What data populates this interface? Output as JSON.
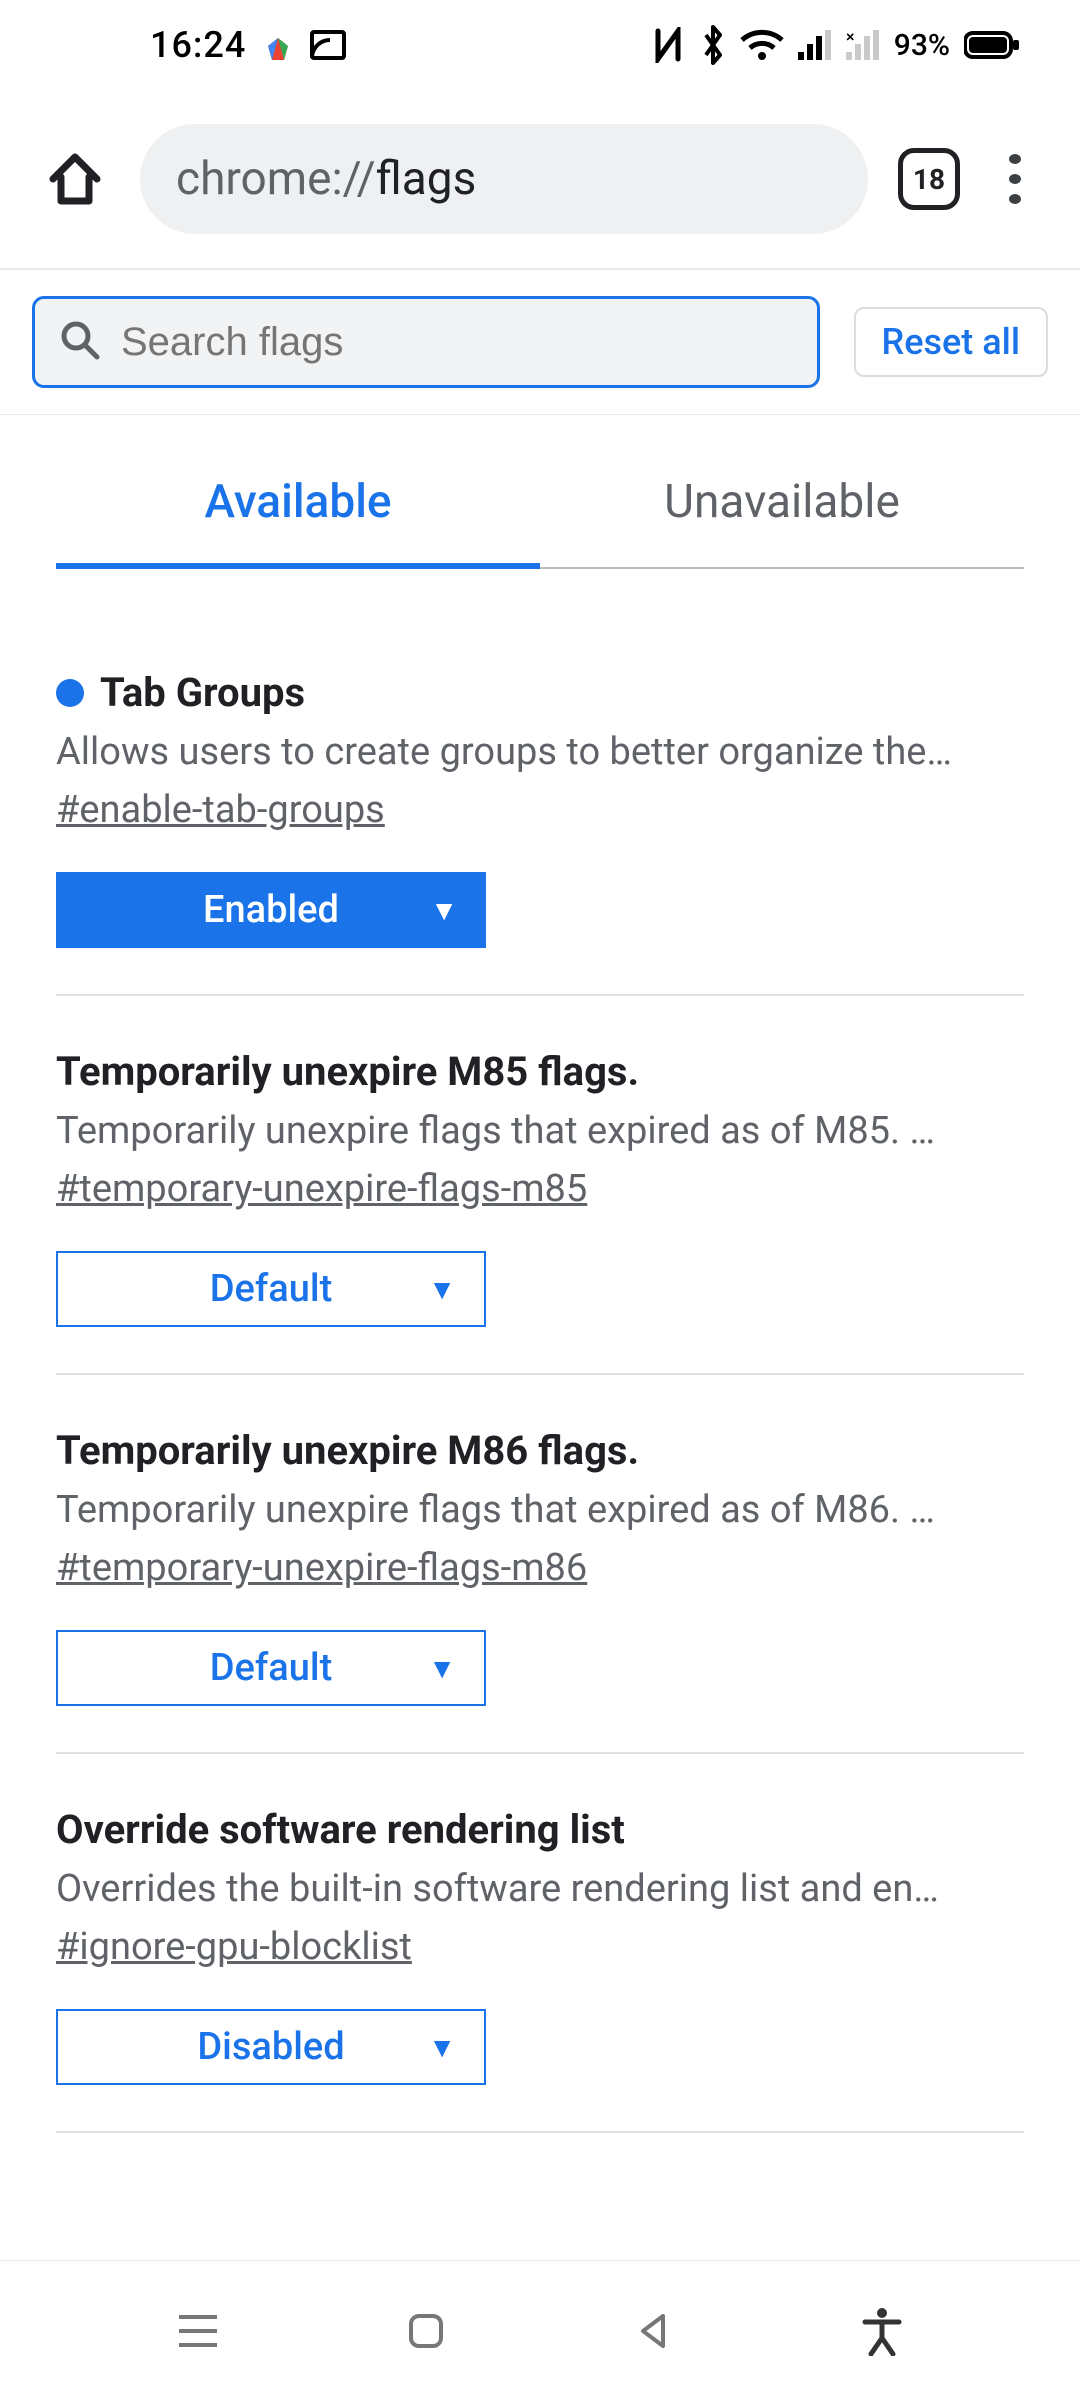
{
  "status": {
    "time": "16:24",
    "battery_percent": "93%"
  },
  "browser": {
    "url_prefix": "chrome://",
    "url_suffix": "flags",
    "tab_count": "18"
  },
  "search": {
    "placeholder": "Search flags",
    "reset_label": "Reset all"
  },
  "tabs": {
    "available": "Available",
    "unavailable": "Unavailable"
  },
  "flags": [
    {
      "title": "Tab Groups",
      "description": "Allows users to create groups to better organize the…",
      "anchor": "#enable-tab-groups",
      "value": "Enabled",
      "highlighted": true,
      "style": "filled"
    },
    {
      "title": "Temporarily unexpire M85 flags.",
      "description": "Temporarily unexpire flags that expired as of M85. …",
      "anchor": "#temporary-unexpire-flags-m85",
      "value": "Default",
      "highlighted": false,
      "style": "outlined"
    },
    {
      "title": "Temporarily unexpire M86 flags.",
      "description": "Temporarily unexpire flags that expired as of M86. …",
      "anchor": "#temporary-unexpire-flags-m86",
      "value": "Default",
      "highlighted": false,
      "style": "outlined"
    },
    {
      "title": "Override software rendering list",
      "description": "Overrides the built-in software rendering list and en…",
      "anchor": "#ignore-gpu-blocklist",
      "value": "Disabled",
      "highlighted": false,
      "style": "outlined"
    }
  ]
}
